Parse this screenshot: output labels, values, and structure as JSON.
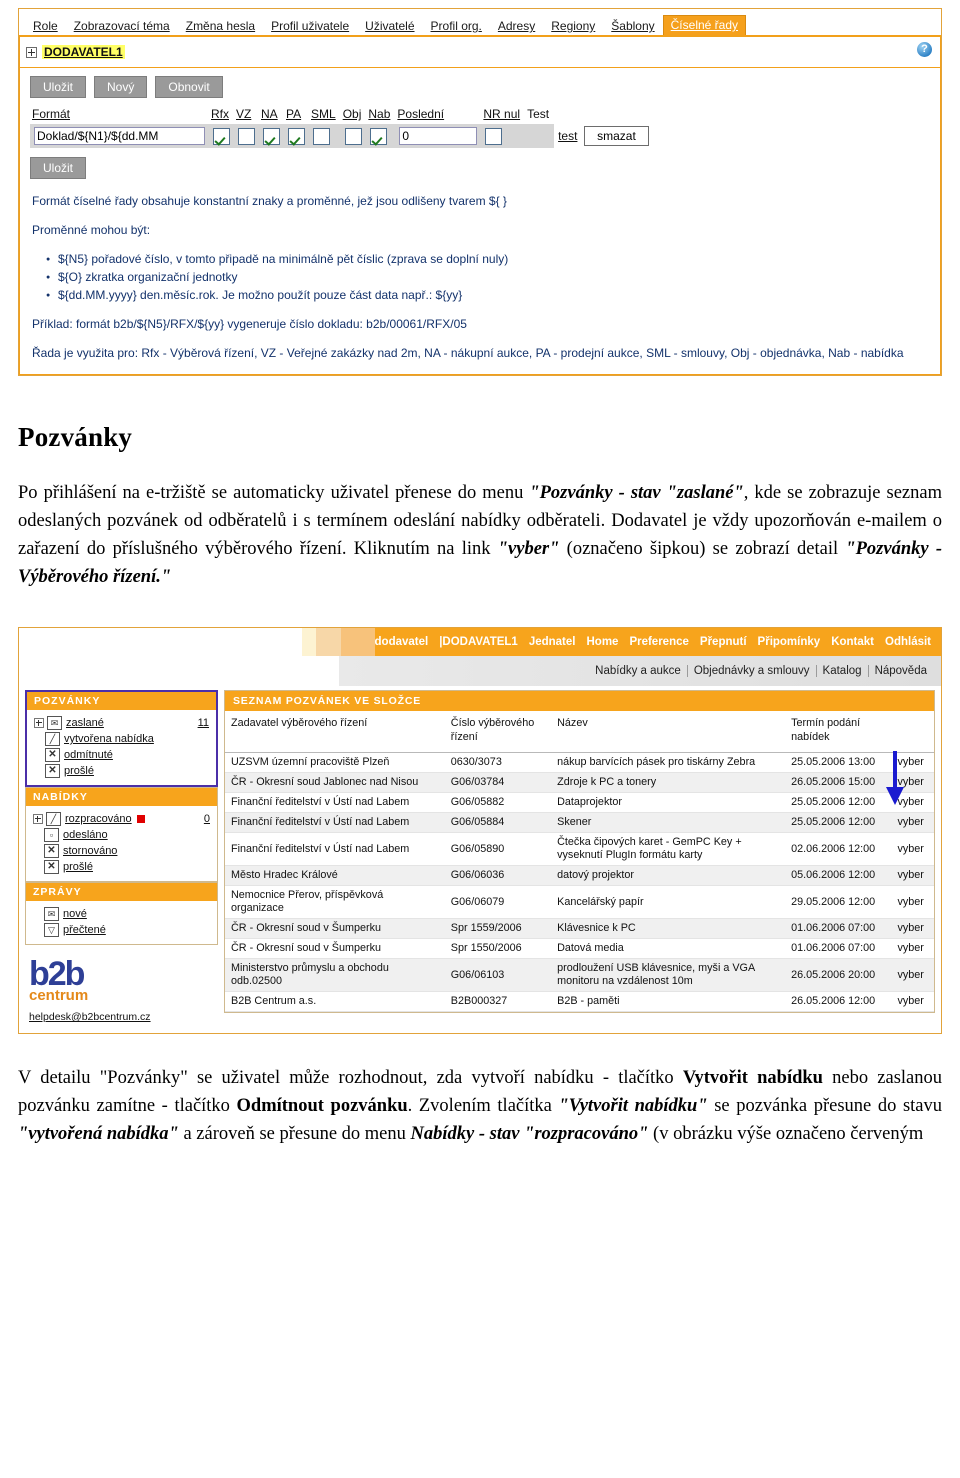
{
  "screenshot1": {
    "tabs": [
      {
        "label": "Role",
        "active": false
      },
      {
        "label": "Zobrazovací téma",
        "active": false
      },
      {
        "label": "Změna hesla",
        "active": false
      },
      {
        "label": "Profil uživatele",
        "active": false
      },
      {
        "label": "Uživatelé",
        "active": false
      },
      {
        "label": "Profil org.",
        "active": false
      },
      {
        "label": "Adresy",
        "active": false
      },
      {
        "label": "Regiony",
        "active": false
      },
      {
        "label": "Šablony",
        "active": false
      },
      {
        "label": "Číselné řady",
        "active": true
      }
    ],
    "org_name": "DODAVATEL1",
    "help_icon": "?",
    "buttons": {
      "save": "Uložit",
      "new": "Nový",
      "refresh": "Obnovit",
      "save_bottom": "Uložit",
      "delete": "smazat",
      "test_link": "test"
    },
    "columns": {
      "format": "Formát",
      "rfx": "Rfx",
      "vz": "VZ",
      "na": "NA",
      "pa": "PA",
      "sml": "SML",
      "obj": "Obj",
      "nab": "Nab",
      "posledni": "Poslední",
      "nr_nul": "NR nul",
      "test": "Test"
    },
    "row": {
      "format_value": "Doklad/${N1}/${dd.MM",
      "rfx_checked": true,
      "vz_checked": false,
      "na_checked": true,
      "pa_checked": true,
      "sml_checked": false,
      "obj_checked": false,
      "nab_checked": true,
      "posledni_value": "0",
      "nr_nul_checked": false
    },
    "help": {
      "line1": "Formát číselné řady obsahuje konstantní znaky a proměnné, jež jsou odlišeny tvarem ${ }",
      "line2": "Proměnné mohou být:",
      "bullets": [
        "${N5} pořadové číslo, v tomto připadě na minimálně pět číslic (zprava se doplní nuly)",
        "${O} zkratka organizační jednotky",
        "${dd.MM.yyyy} den.měsíc.rok. Je možno použít pouze část data např.: ${yy}"
      ],
      "example": "Příklad: formát b2b/${N5}/RFX/${yy} vygeneruje číslo dokladu: b2b/00061/RFX/05",
      "usage": "Řada je využita pro: Rfx - Výběrová řízení, VZ - Veřejné zakázky nad 2m, NA - nákupní aukce, PA - prodejní aukce, SML - smlouvy, Obj - objednávka, Nab - nabídka"
    }
  },
  "document": {
    "title": "Pozvánky",
    "paragraph1_parts": {
      "p1": "Po přihlášení na e-tržiště se automaticky uživatel přenese do menu ",
      "q1": "\"Pozvánky - stav \"zaslané\"",
      "p2": ", kde se zobrazuje seznam odeslaných pozvánek od odběratelů i s termínem odeslání nabídky odběrateli. Dodavatel je vždy upozorňován e-mailem o zařazení do příslušného výběrového řízení. Kliknutím na link ",
      "q2": "\"vyber\"",
      "p3": " (označeno šipkou) se zobrazí detail ",
      "q3": "\"Pozvánky - Výběrového řízení.\""
    },
    "paragraph2_parts": {
      "p1": "V detailu \"Pozvánky\" se uživatel může rozhodnout, zda vytvoří nabídku - tlačítko ",
      "b1": "Vytvořit nabídku",
      "p2": " nebo zaslanou pozvánku zamítne - tlačítko ",
      "b2": "Odmítnout pozvánku",
      "p3": ". Zvolením tlačítka ",
      "q1": "\"Vytvořit nabídku\"",
      "p4": " se pozvánka přesune do stavu ",
      "q2": "\"vytvořená nabídka\"",
      "p5": " a zároveň se přesune do menu ",
      "q3": "Nabídky - stav \"rozpracováno\"",
      "p6": " (v obrázku výše označeno červeným"
    }
  },
  "screenshot2": {
    "topnav": {
      "role_label": "dodavatel",
      "items": [
        "|DODAVATEL1",
        "Jednatel",
        "Home",
        "Preference",
        "Přepnutí",
        "Připomínky",
        "Kontakt",
        "Odhlásit"
      ]
    },
    "subnav": {
      "items": [
        "Nabídky a aukce",
        "Objednávky a smlouvy",
        "Katalog",
        "Nápověda"
      ]
    },
    "sidebar": {
      "groups": [
        {
          "title": "POZVÁNKY",
          "highlight": true,
          "items": [
            {
              "label": "zaslané",
              "count": "11",
              "icon": "envelope-icon",
              "expandable": true
            },
            {
              "label": "vytvořena nabídka",
              "count": "",
              "icon": "note-icon",
              "expandable": false
            },
            {
              "label": "odmítnuté",
              "count": "",
              "icon": "x-icon",
              "expandable": false
            },
            {
              "label": "prošlé",
              "count": "",
              "icon": "x-icon",
              "expandable": false
            }
          ]
        },
        {
          "title": "NABÍDKY",
          "highlight": false,
          "items": [
            {
              "label": "rozpracováno",
              "count": "0",
              "icon": "note-icon",
              "expandable": true,
              "marker": true
            },
            {
              "label": "odesláno",
              "count": "",
              "icon": "tray-icon",
              "expandable": false
            },
            {
              "label": "stornováno",
              "count": "",
              "icon": "x-icon",
              "expandable": false
            },
            {
              "label": "prošlé",
              "count": "",
              "icon": "x-icon",
              "expandable": false
            }
          ]
        },
        {
          "title": "ZPRÁVY",
          "highlight": false,
          "items": [
            {
              "label": "nové",
              "count": "",
              "icon": "envelope-icon",
              "expandable": false
            },
            {
              "label": "přečtené",
              "count": "",
              "icon": "envelope-open-icon",
              "expandable": false
            }
          ]
        }
      ],
      "logo_main": "b2b",
      "logo_sub": "centrum",
      "helpdesk_email": "helpdesk@b2bcentrum.cz"
    },
    "main": {
      "header": "SEZNAM POZVÁNEK VE SLOŽCE",
      "columns": {
        "zadavatel": "Zadavatel výběrového řízení",
        "cislo": "Číslo výběrového řízení",
        "nazev": "Název",
        "termin": "Termín podání nabídek",
        "action": ""
      },
      "action_label": "vyber",
      "rows": [
        {
          "zadavatel": "UZSVM územní pracoviště Plzeň",
          "cislo": "0630/3073",
          "nazev": "nákup barvících pásek pro tiskárny Zebra",
          "termin": "25.05.2006 13:00",
          "action": "vyber"
        },
        {
          "zadavatel": "ČR - Okresní soud Jablonec nad Nisou",
          "cislo": "G06/03784",
          "nazev": "Zdroje k PC a tonery",
          "termin": "26.05.2006 15:00",
          "action": "vyber"
        },
        {
          "zadavatel": "Finanční ředitelství v Ústí nad Labem",
          "cislo": "G06/05882",
          "nazev": "Dataprojektor",
          "termin": "25.05.2006 12:00",
          "action": "vyber"
        },
        {
          "zadavatel": "Finanční ředitelství v Ústí nad Labem",
          "cislo": "G06/05884",
          "nazev": "Skener",
          "termin": "25.05.2006 12:00",
          "action": "vyber"
        },
        {
          "zadavatel": "Finanční ředitelství v Ústí nad Labem",
          "cislo": "G06/05890",
          "nazev": "Čtečka čipových karet - GemPC Key + vyseknutí PlugIn formátu karty",
          "termin": "02.06.2006 12:00",
          "action": "vyber"
        },
        {
          "zadavatel": "Město Hradec Králové",
          "cislo": "G06/06036",
          "nazev": "datový projektor",
          "termin": "05.06.2006 12:00",
          "action": "vyber"
        },
        {
          "zadavatel": "Nemocnice Přerov, příspěvková organizace",
          "cislo": "G06/06079",
          "nazev": "Kancelářský papír",
          "termin": "29.05.2006 12:00",
          "action": "vyber"
        },
        {
          "zadavatel": "ČR - Okresní soud v Šumperku",
          "cislo": "Spr 1559/2006",
          "nazev": "Klávesnice k PC",
          "termin": "01.06.2006 07:00",
          "action": "vyber"
        },
        {
          "zadavatel": "ČR - Okresní soud v Šumperku",
          "cislo": "Spr 1550/2006",
          "nazev": "Datová media",
          "termin": "01.06.2006 07:00",
          "action": "vyber"
        },
        {
          "zadavatel": "Ministerstvo průmyslu a obchodu odb.02500",
          "cislo": "G06/06103",
          "nazev": "prodloužení USB klávesnice, myši a VGA monitoru na vzdálenost 10m",
          "termin": "26.05.2006 20:00",
          "action": "vyber"
        },
        {
          "zadavatel": "B2B Centrum a.s.",
          "cislo": "B2B000327",
          "nazev": "B2B - paměti",
          "termin": "26.05.2006 12:00",
          "action": "vyber"
        }
      ]
    }
  },
  "colors": {
    "orange": "#f7a41c",
    "tab_active": "#f5a01c",
    "highlight_yellow": "#ffff66",
    "link_blue": "#13326b",
    "arrow_blue": "#1a1ad0",
    "marker_red": "#e00000",
    "logo_blue": "#2e3f96"
  }
}
